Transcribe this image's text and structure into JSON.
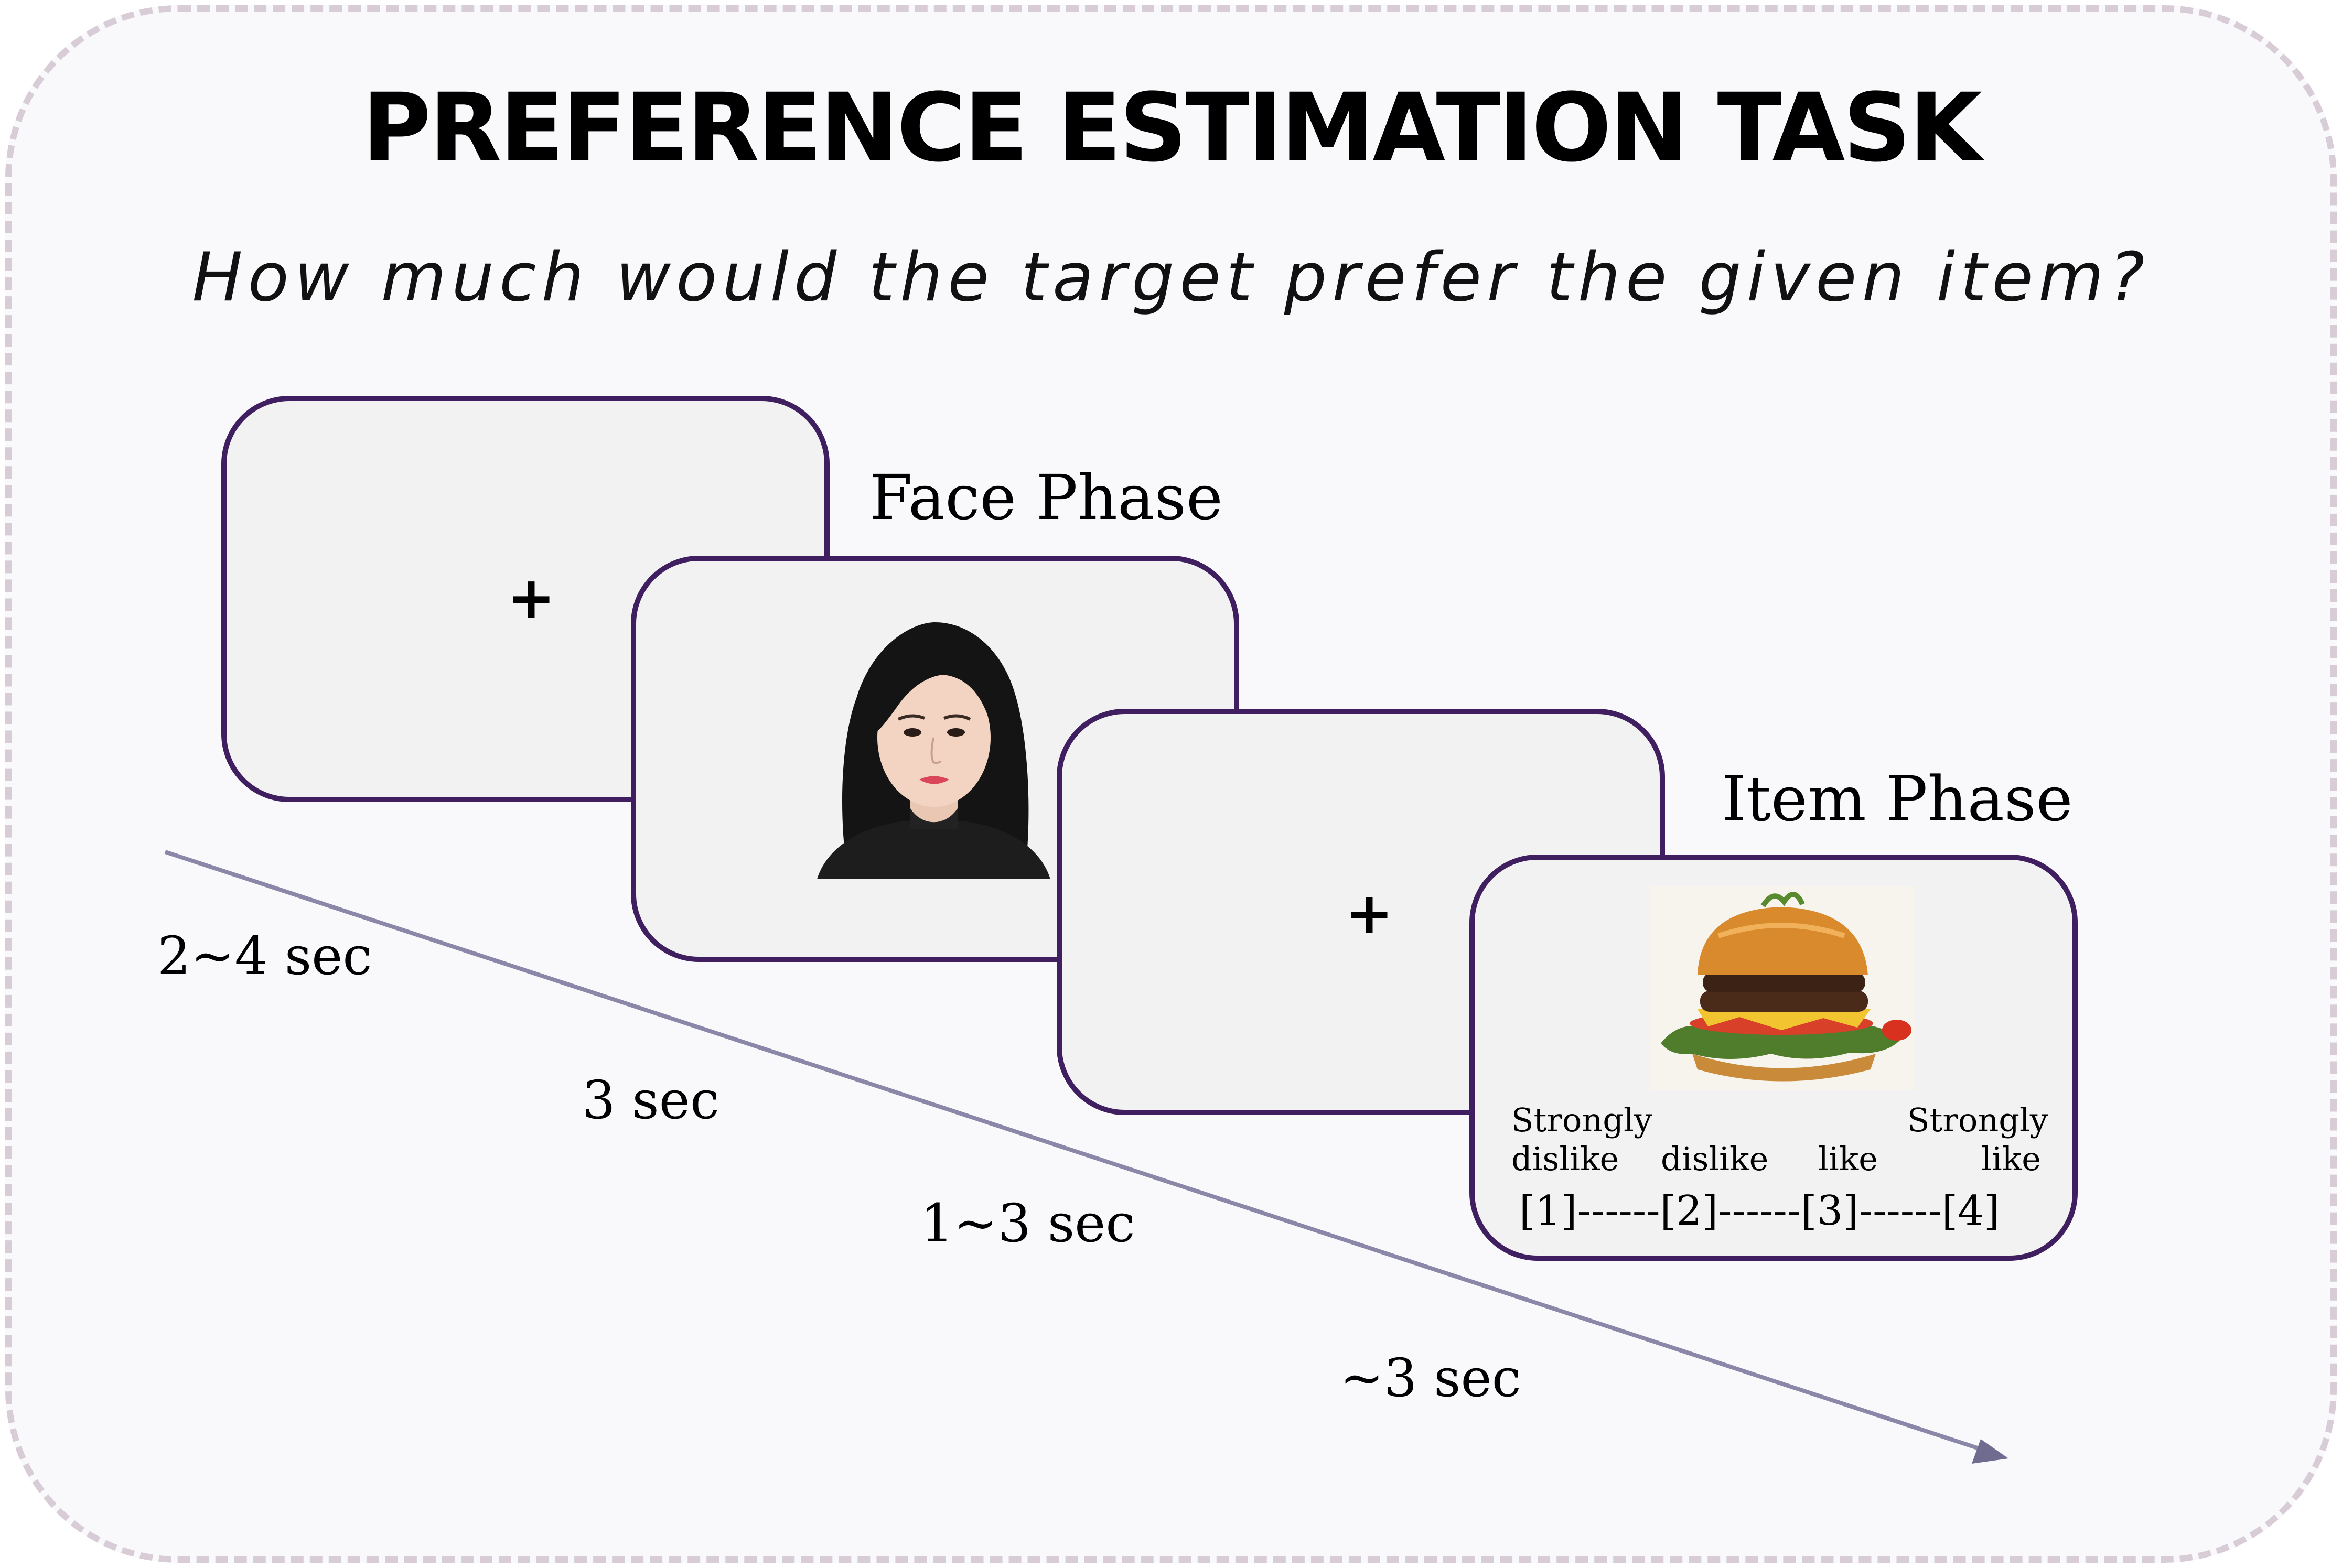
{
  "title": "PREFERENCE ESTIMATION TASK",
  "question": "How much would the target prefer the given item?",
  "cards": {
    "fixation_1": "+",
    "fixation_2": "+"
  },
  "phases": {
    "face_label": "Face Phase",
    "item_label": "Item Phase"
  },
  "timings": [
    "2~4 sec",
    "3 sec",
    "1~3 sec",
    "~3 sec"
  ],
  "rating_scale": {
    "labels": [
      {
        "line1": "Strongly",
        "line2": "dislike"
      },
      {
        "line1": "",
        "line2": "dislike"
      },
      {
        "line1": "",
        "line2": "like"
      },
      {
        "line1": "Strongly",
        "line2": "like"
      }
    ],
    "scale_text": "[1]------[2]------[3]------[4]"
  },
  "colors": {
    "card_border": "#3f1f5f",
    "card_fill": "#f2f2f2",
    "frame_border": "#d8cdd6",
    "arrow": "#8a87a8"
  },
  "images": {
    "face": "face-photo",
    "item": "hamburger-photo"
  }
}
